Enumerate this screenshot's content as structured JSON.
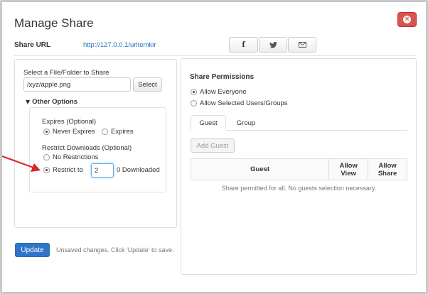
{
  "dialog": {
    "title": "Manage Share",
    "close_icon": "close-icon",
    "close_glyph": "×"
  },
  "share_url": {
    "label": "Share URL",
    "link": "http://127.0.0.1/urltemkir",
    "buttons": [
      {
        "name": "facebook",
        "glyph": "f"
      },
      {
        "name": "twitter",
        "glyph": "🐦"
      },
      {
        "name": "email",
        "glyph": "✉"
      }
    ]
  },
  "left_panel": {
    "select_label": "Select a File/Folder to Share",
    "path_value": "/xyz/apple.png",
    "select_button": "Select",
    "other_options": "Other Options",
    "toggle_glyph": "▼",
    "expires_label": "Expires (Optional)",
    "never_expires": "Never Expires",
    "expires": "Expires",
    "restrict_label": "Restrict Downloads (Optional)",
    "no_restrictions": "No Restrictions",
    "restrict_to": "Restrict to",
    "restrict_value": "2",
    "downloaded": "0 Downloaded"
  },
  "right_panel": {
    "heading": "Share Permissions",
    "allow_everyone": "Allow Everyone",
    "allow_selected": "Allow Selected Users/Groups",
    "tabs": [
      "Guest",
      "Group"
    ],
    "add_guest": "Add Guest",
    "table": {
      "headers": [
        "Guest",
        "Allow View",
        "Allow Share"
      ],
      "empty_message": "Share permitted for all. No guests selection necessary."
    }
  },
  "footer": {
    "update": "Update",
    "unsaved": "Unsaved changes. Click 'Update' to save."
  },
  "colors": {
    "accent": "#2f76c9",
    "close": "#d9534f",
    "arrow": "#d9262c"
  }
}
